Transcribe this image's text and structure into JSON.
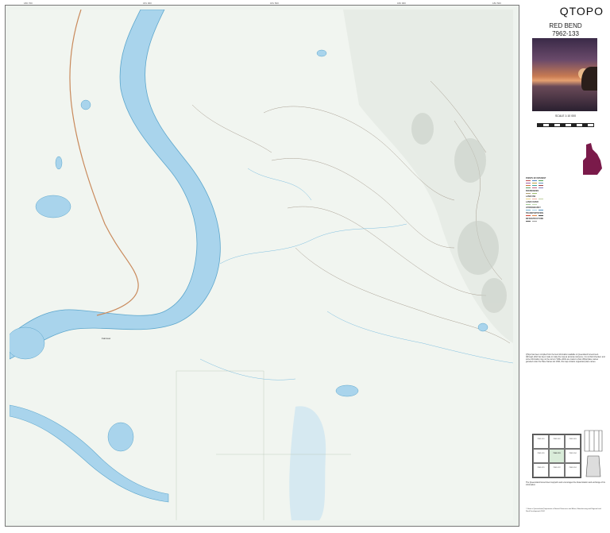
{
  "header": {
    "brand": "QTOPO",
    "sheet_name": "RED BEND",
    "sheet_number": "7962-133"
  },
  "scale_text": "SCALE 1:10 000",
  "map": {
    "place_label": "Fairview",
    "grid_ticks_top": [
      "180 700",
      "181 000",
      "181 500",
      "182 000",
      "182 500"
    ],
    "colors": {
      "river": "#a9d4ec",
      "river_edge": "#5ca6cc",
      "road": "#c98a5c",
      "land": "#f1f5f0",
      "contour": "#8a7a6a",
      "wetland": "#cfe6f1"
    }
  },
  "legend": {
    "heading": "POINTS OF INTEREST",
    "sections": [
      "BOUNDARIES",
      "LAND USE",
      "LAND COVER",
      "HYDROGRAPHY",
      "TRANSPORTATION",
      "INFRASTRUCTURE"
    ]
  },
  "disclaimer": "QTopo has been compiled from the best information available to Queensland Government. Although effort has been made to make the map as accurate reference, it is not field checked, and some information may not be current. While efforts are made to show official place names gazetted under the Place Names Act 1994, this map contains unguarded place names.",
  "index": {
    "cells": [
      "7962-141",
      "7962-142",
      "7962-143",
      "7962-131",
      "7962-133",
      "7962-134",
      "7962-121",
      "7962-122",
      "7962-124"
    ],
    "current": "7962-133"
  },
  "footer": "The Queensland Government supports and encourages the dissemination and exchange of its information.",
  "copyright": "© State of Queensland (Department of Natural Resources and Mines, Manufacturing and Regional and Rural Development) 2024"
}
